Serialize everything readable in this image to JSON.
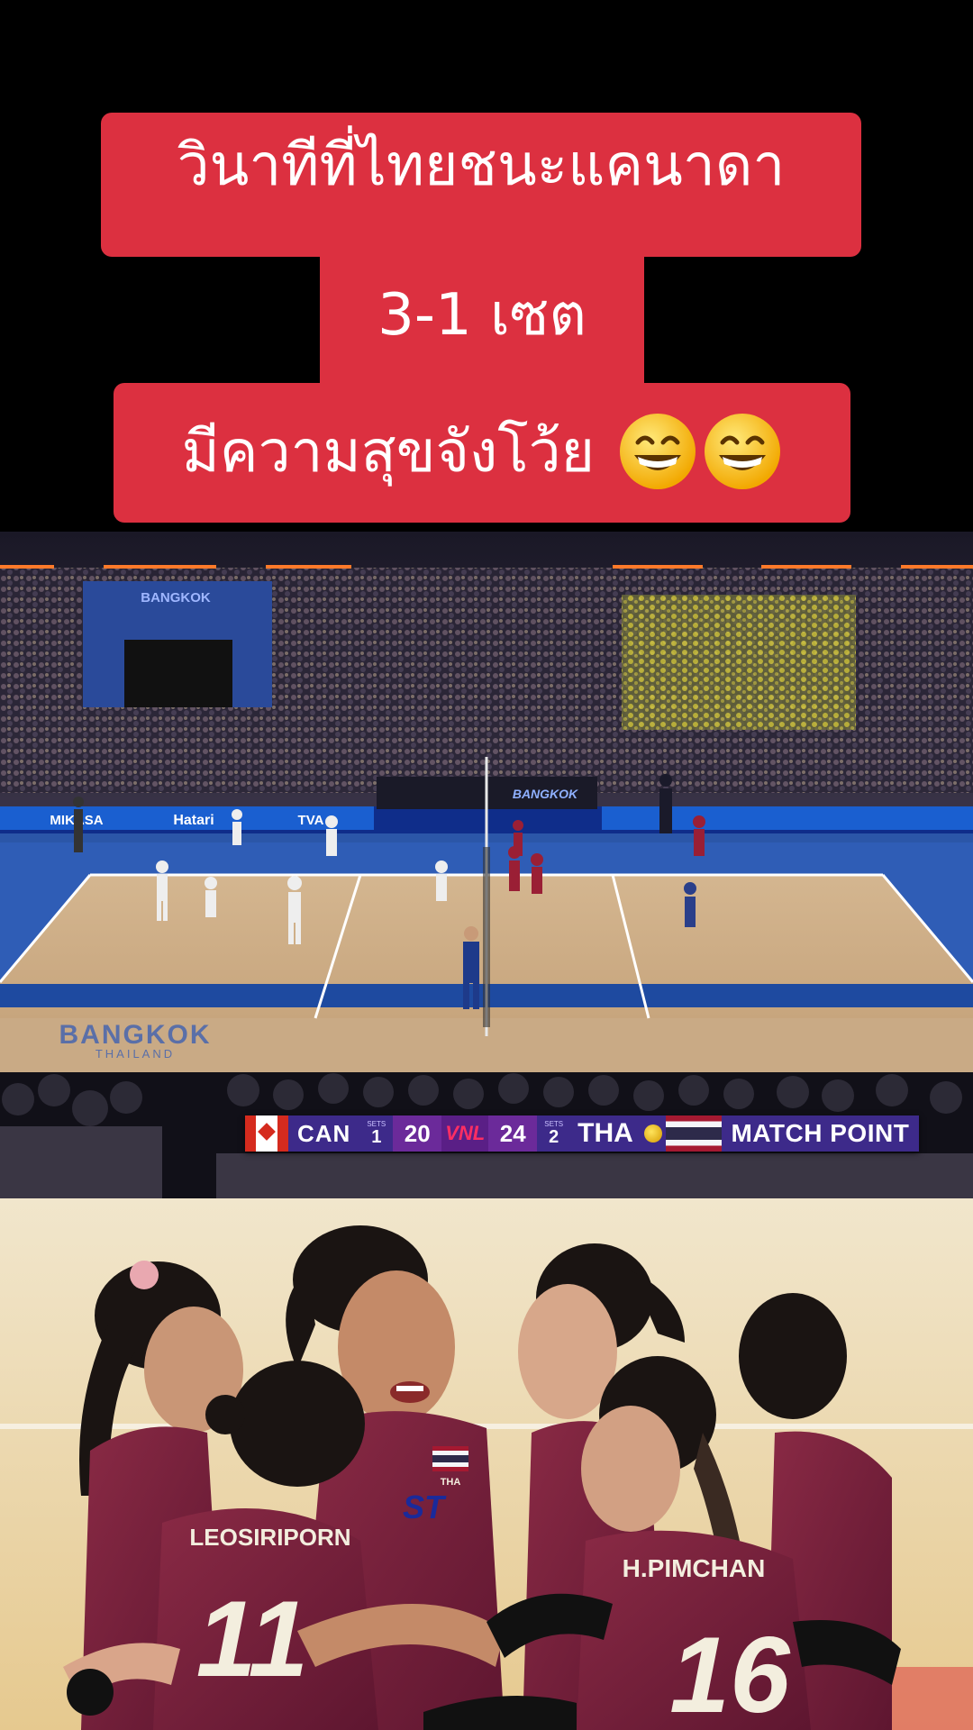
{
  "caption": {
    "line1": "วินาทีที่ไทยชนะแคนาดา",
    "line2": "3-1 เซต",
    "line3": "มีความสุขจังโว้ย",
    "emojis": [
      "grinning-face-with-smiling-eyes",
      "grinning-face-with-smiling-eyes"
    ],
    "background_color": "#dc3040",
    "text_color": "#ffffff"
  },
  "broadcast": {
    "arena_sign": "BANGKOK",
    "court_text": "BANGKOK",
    "court_subtext": "THAILAND",
    "ad_boards": [
      "MIKASA",
      "Hatari",
      "TVA"
    ],
    "center_board": "BANGKOK",
    "scoreboard": {
      "team1": "CAN",
      "team1_sets_label": "SETS",
      "team1_sets": "1",
      "team1_score": "20",
      "league_logo": "VNL",
      "team2_score": "24",
      "team2_sets_label": "SETS",
      "team2_sets": "2",
      "team2": "THA",
      "status": "MATCH POINT"
    }
  },
  "photo": {
    "jersey_names": [
      "LEOSIRIPORN",
      "H.PIMCHAN"
    ],
    "jersey_numbers": [
      "11",
      "16"
    ],
    "chest_text": "THA",
    "sponsor_text": "ST"
  }
}
